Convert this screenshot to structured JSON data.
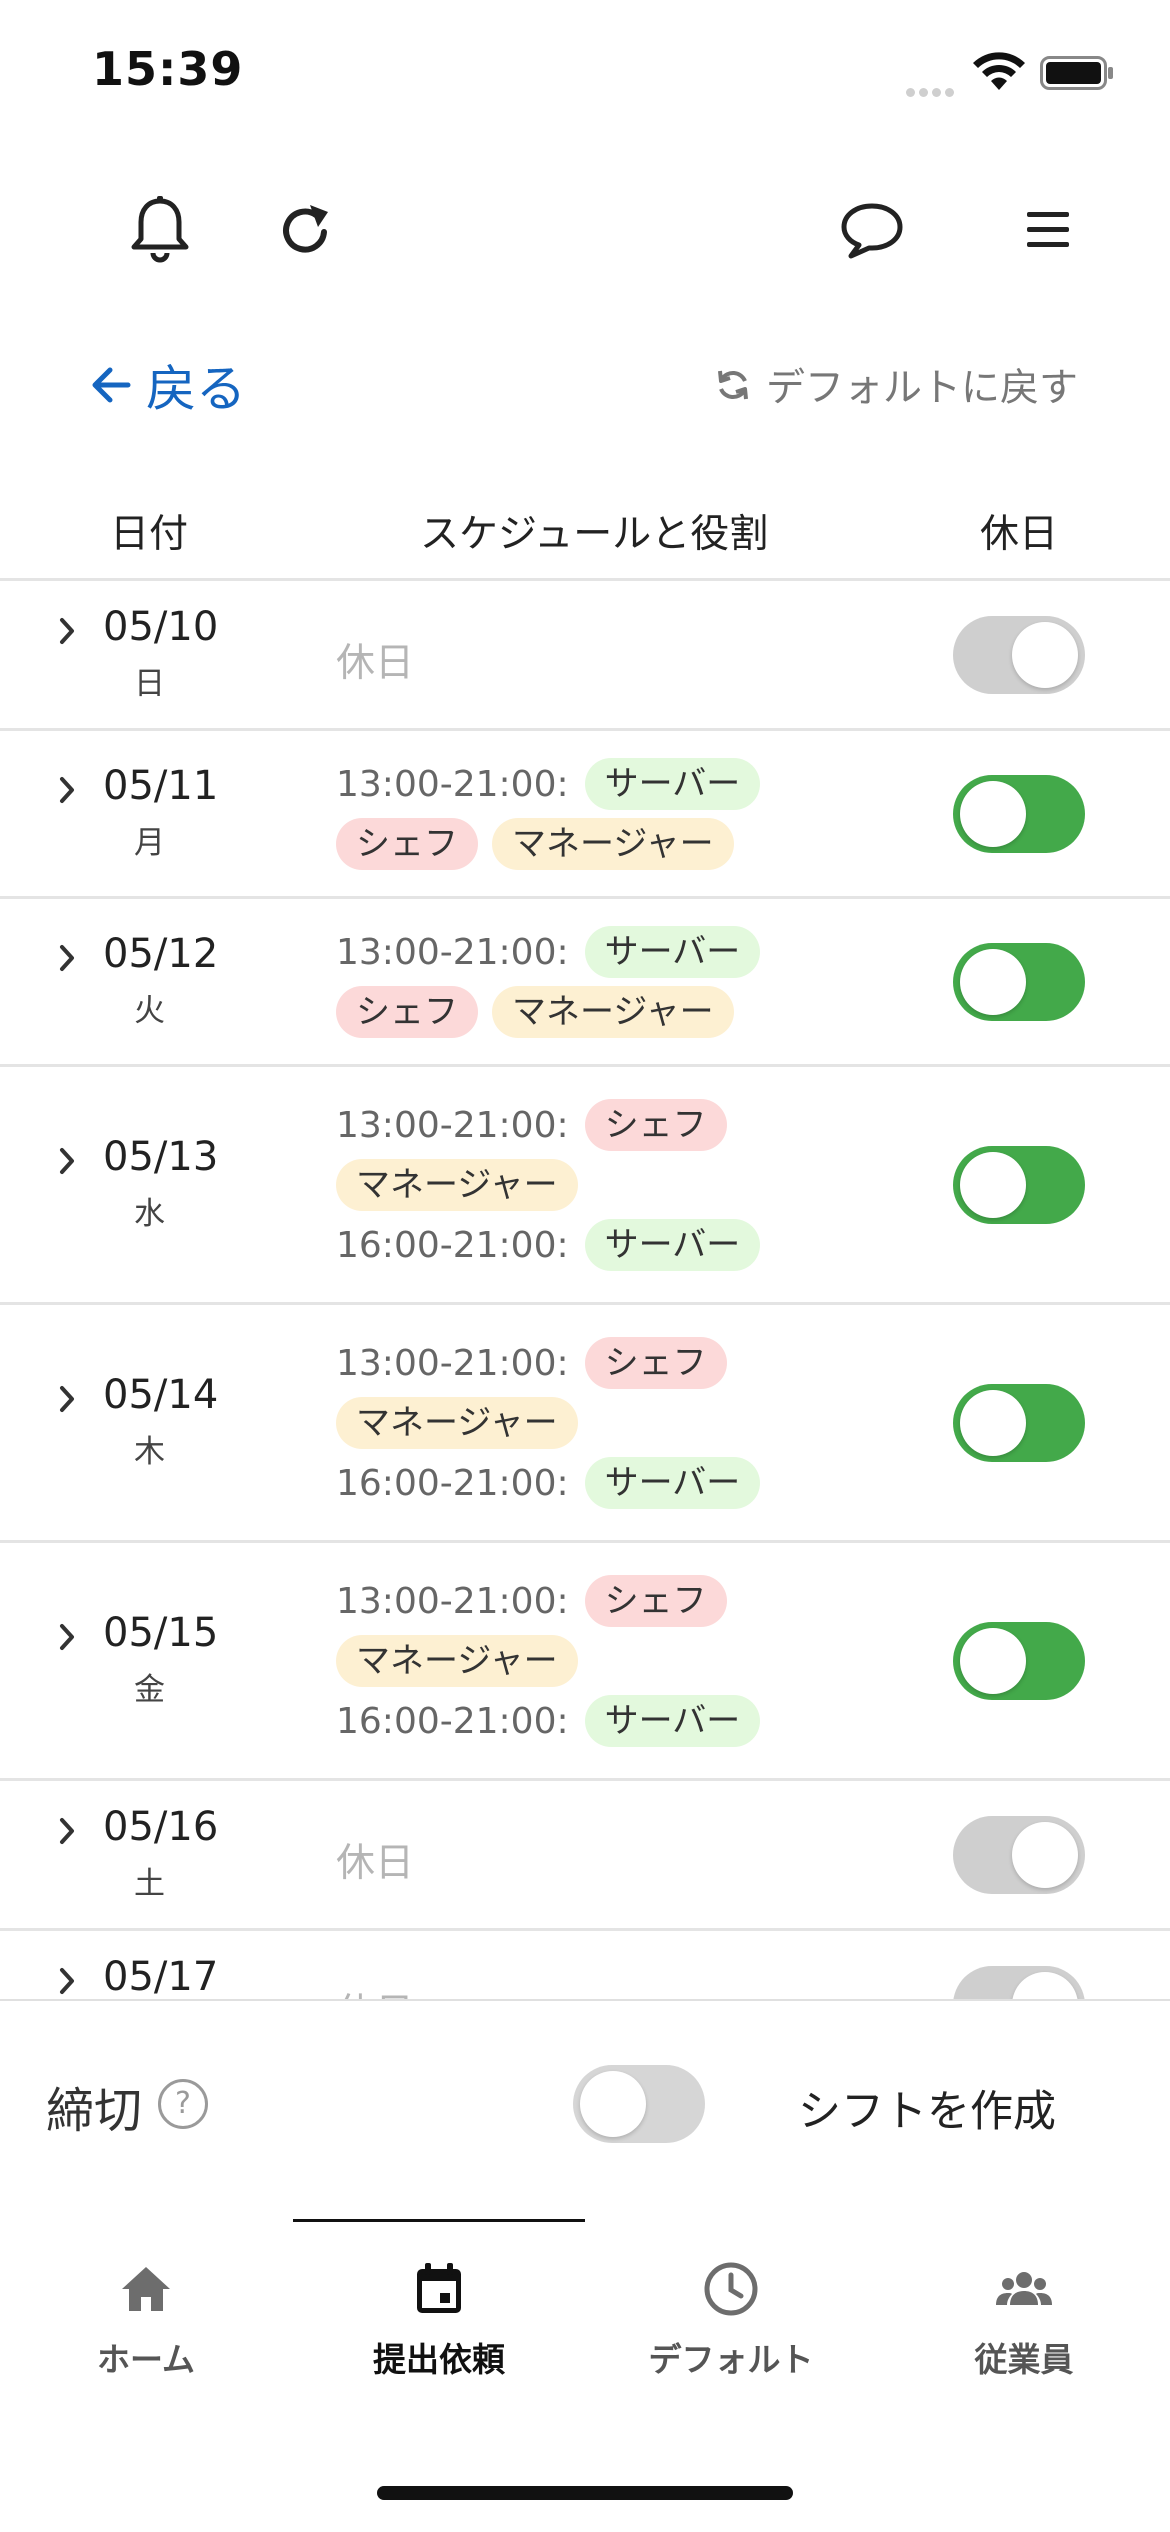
{
  "status": {
    "time": "15:39"
  },
  "nav": {
    "back_label": "戻る",
    "reset_label": "デフォルトに戻す"
  },
  "table": {
    "headers": {
      "date": "日付",
      "schedule": "スケジュールと役割",
      "day_off": "休日"
    },
    "rows": [
      {
        "date": "05/10",
        "weekday": "日",
        "off": true,
        "off_label": "休日"
      },
      {
        "date": "05/11",
        "weekday": "月",
        "off": false,
        "lines": [
          {
            "time": "13:00-21:00:",
            "tags": [
              "サーバー"
            ]
          },
          {
            "time": "",
            "tags": [
              "シェフ",
              "マネージャー"
            ]
          }
        ]
      },
      {
        "date": "05/12",
        "weekday": "火",
        "off": false,
        "lines": [
          {
            "time": "13:00-21:00:",
            "tags": [
              "サーバー"
            ]
          },
          {
            "time": "",
            "tags": [
              "シェフ",
              "マネージャー"
            ]
          }
        ]
      },
      {
        "date": "05/13",
        "weekday": "水",
        "off": false,
        "lines": [
          {
            "time": "13:00-21:00:",
            "tags": [
              "シェフ"
            ]
          },
          {
            "time": "",
            "tags": [
              "マネージャー"
            ]
          },
          {
            "time": "16:00-21:00:",
            "tags": [
              "サーバー"
            ]
          }
        ]
      },
      {
        "date": "05/14",
        "weekday": "木",
        "off": false,
        "lines": [
          {
            "time": "13:00-21:00:",
            "tags": [
              "シェフ"
            ]
          },
          {
            "time": "",
            "tags": [
              "マネージャー"
            ]
          },
          {
            "time": "16:00-21:00:",
            "tags": [
              "サーバー"
            ]
          }
        ]
      },
      {
        "date": "05/15",
        "weekday": "金",
        "off": false,
        "lines": [
          {
            "time": "13:00-21:00:",
            "tags": [
              "シェフ"
            ]
          },
          {
            "time": "",
            "tags": [
              "マネージャー"
            ]
          },
          {
            "time": "16:00-21:00:",
            "tags": [
              "サーバー"
            ]
          }
        ]
      },
      {
        "date": "05/16",
        "weekday": "土",
        "off": true,
        "off_label": "休日"
      },
      {
        "date": "05/17",
        "weekday": "",
        "off": true,
        "off_label": "休日"
      }
    ]
  },
  "tag_colors": {
    "サーバー": "#e3f9dd",
    "シェフ": "#fcd9d9",
    "マネージャー": "#fdf0d2"
  },
  "footer": {
    "deadline_label": "締切",
    "help": "?",
    "deadline_toggle_on": false,
    "create_label": "シフトを作成"
  },
  "tabs": [
    {
      "label": "ホーム",
      "icon": "home-icon",
      "active": false
    },
    {
      "label": "提出依頼",
      "icon": "calendar-icon",
      "active": true
    },
    {
      "label": "デフォルト",
      "icon": "clock-icon",
      "active": false
    },
    {
      "label": "従業員",
      "icon": "people-icon",
      "active": false
    }
  ],
  "colors": {
    "accent": "#1565c0",
    "toggle_on": "#43a94a",
    "toggle_off": "#cfcfcf"
  }
}
